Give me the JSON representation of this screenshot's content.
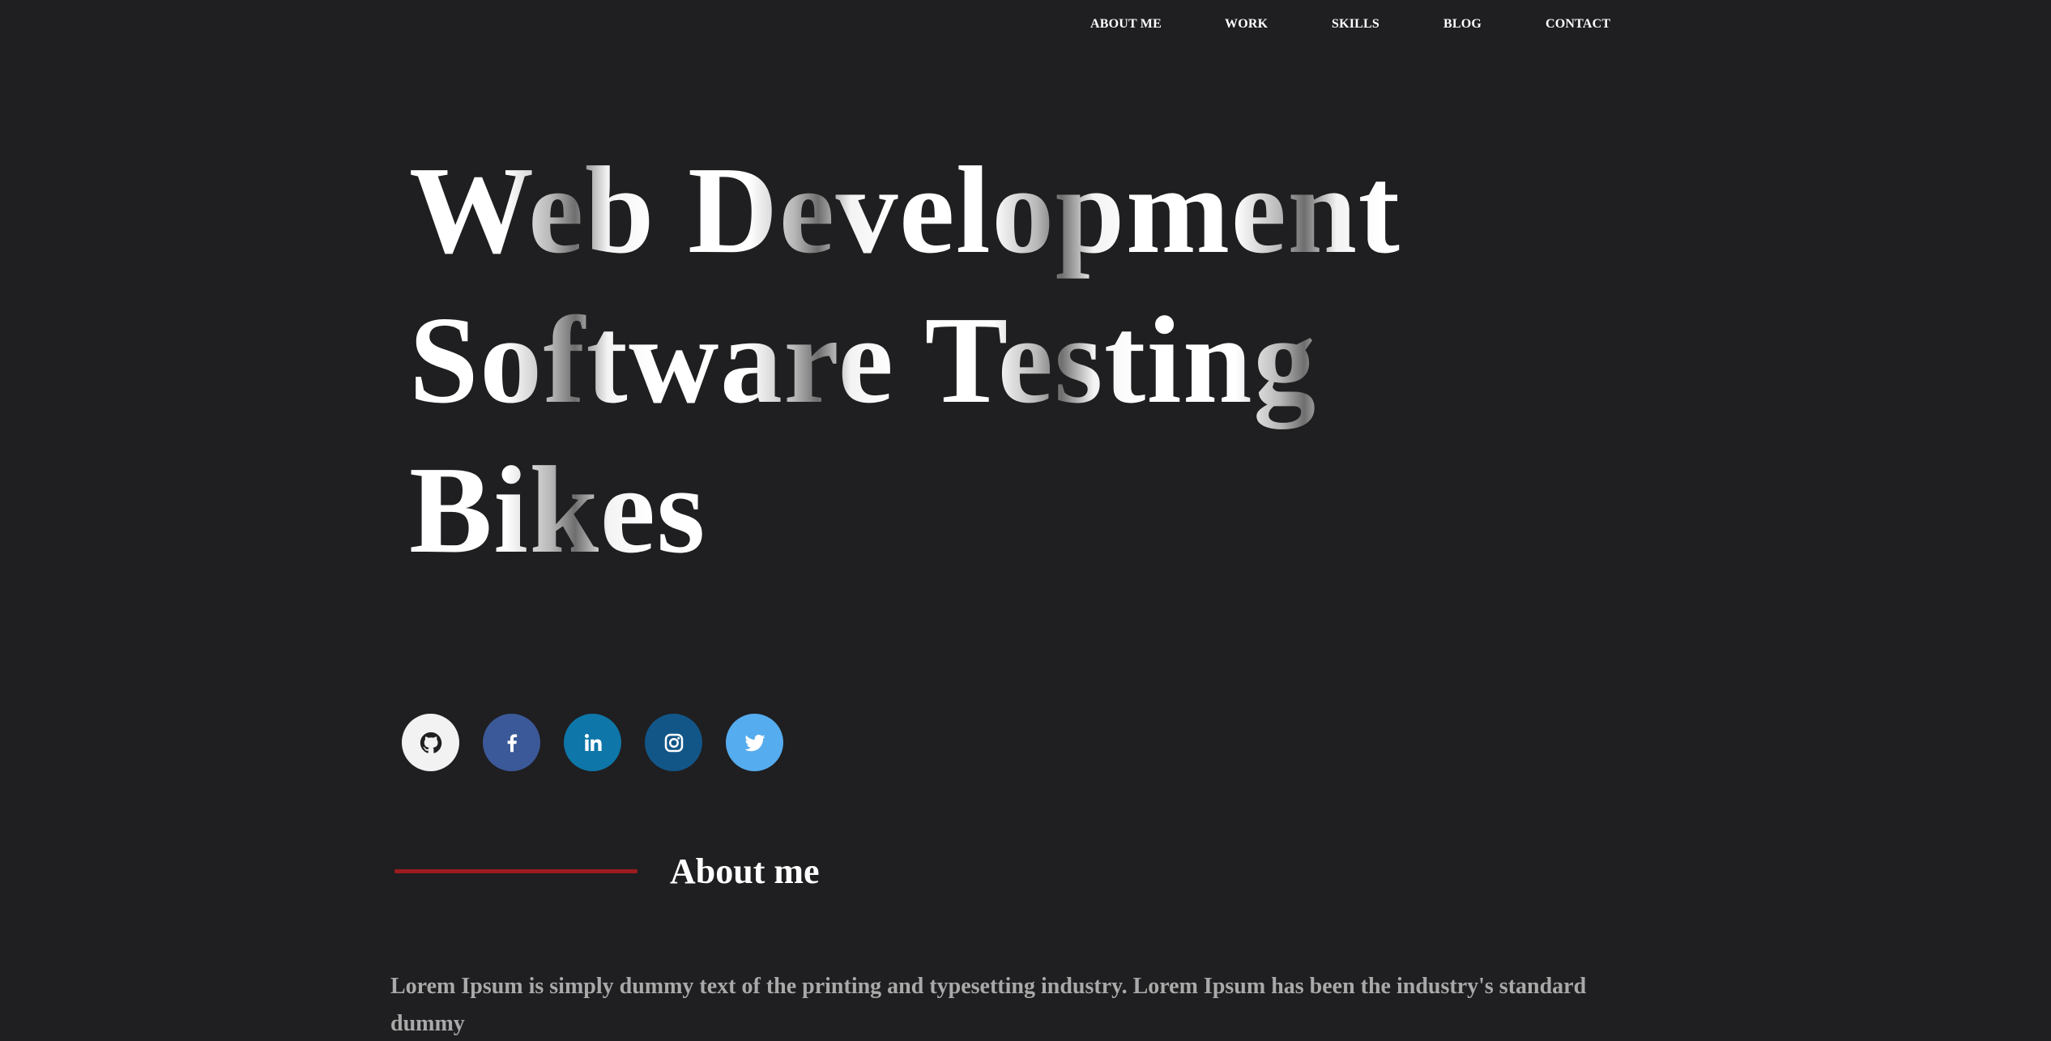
{
  "nav": {
    "items": [
      {
        "label": "ABOUT ME"
      },
      {
        "label": "WORK"
      },
      {
        "label": "SKILLS"
      },
      {
        "label": "BLOG"
      },
      {
        "label": "CONTACT"
      }
    ]
  },
  "hero": {
    "lines": [
      "Web Development",
      "Software Testing",
      "Bikes"
    ]
  },
  "social": [
    {
      "icon": "github-icon",
      "bg": "#f2f2f2",
      "fg": "#1f1e20"
    },
    {
      "icon": "facebook-icon",
      "bg": "#3b5998",
      "fg": "#ffffff"
    },
    {
      "icon": "linkedin-icon",
      "bg": "#0e76a8",
      "fg": "#ffffff"
    },
    {
      "icon": "instagram-icon",
      "bg": "#125688",
      "fg": "#ffffff"
    },
    {
      "icon": "twitter-icon",
      "bg": "#55acee",
      "fg": "#ffffff"
    }
  ],
  "about": {
    "title": "About me",
    "body": "Lorem Ipsum is simply dummy text of the printing and typesetting industry. Lorem Ipsum has been the industry's standard dummy"
  },
  "colors": {
    "background": "#1f1e20",
    "accent": "#9d1c1f",
    "body_text": "#a9a9a9"
  }
}
